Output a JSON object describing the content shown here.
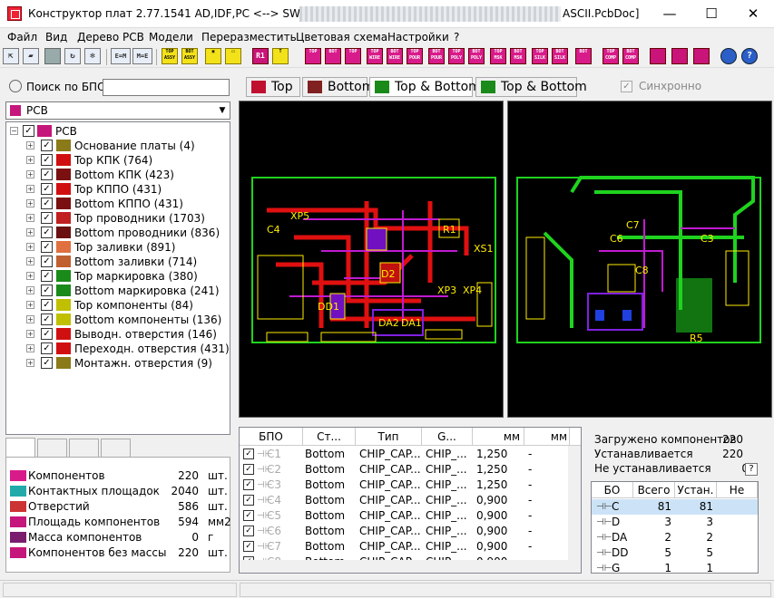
{
  "title": {
    "text": "Конструктор плат 2.77.1541  AD,IDF,PC <--> SW  Demo",
    "suffix": "ASCII.PcbDoc]",
    "minimize": "—",
    "maximize": "☐",
    "close": "✕"
  },
  "menu": [
    "Файл",
    "Вид",
    "Дерево PCB",
    "Модели",
    "Переразместить",
    "Цветовая схема",
    "Настройки",
    "?"
  ],
  "toolbar": {
    "top_labels": [
      "TOP ASSY",
      "BOT ASSY",
      "TOP",
      "BOT",
      "TOP WIRE",
      "BOT WIRE",
      "TOP POUR",
      "BOT POUR",
      "TOP POLY",
      "BOT POLY",
      "TOP MSK",
      "BOT MSK",
      "TOP SILK",
      "BOT SILK",
      "TOP COMP",
      "BOT COMP"
    ],
    "misc_labels": [
      "E=M",
      "M=E",
      "R1"
    ]
  },
  "search": {
    "label": "Поиск по БПО:",
    "value": ""
  },
  "combo": {
    "value": "PCB"
  },
  "tree": {
    "root": "PCB",
    "items": [
      {
        "label": "Основание платы  (4)",
        "icon": "board-base-icon",
        "color": "#8a7a1a"
      },
      {
        "label": "Top КПК  (764)",
        "icon": "smd-pad-icon",
        "color": "#d01010"
      },
      {
        "label": "Bottom КПК  (423)",
        "icon": "smd-pad-icon",
        "color": "#7a1010"
      },
      {
        "label": "Top КППО  (431)",
        "icon": "through-pad-icon",
        "color": "#d01010"
      },
      {
        "label": "Bottom КППО  (431)",
        "icon": "through-pad-icon",
        "color": "#7a1010"
      },
      {
        "label": "Top проводники  (1703)",
        "icon": "track-icon",
        "color": "#c02020"
      },
      {
        "label": "Bottom проводники  (836)",
        "icon": "track-icon",
        "color": "#6a1010"
      },
      {
        "label": "Top заливки  (891)",
        "icon": "polygon-icon",
        "color": "#e07040"
      },
      {
        "label": "Bottom заливки  (714)",
        "icon": "polygon-icon",
        "color": "#c06030"
      },
      {
        "label": "Top маркировка  (380)",
        "icon": "silkscreen-icon",
        "color": "#1a8a1a"
      },
      {
        "label": "Bottom маркировка  (241)",
        "icon": "silkscreen-icon",
        "color": "#1a8a1a"
      },
      {
        "label": "Top компоненты  (84)",
        "icon": "top-component-icon",
        "color": "#c0c000"
      },
      {
        "label": "Bottom компоненты  (136)",
        "icon": "bottom-component-icon",
        "color": "#c0c000"
      },
      {
        "label": "Выводн. отверстия  (146)",
        "icon": "pin-hole-icon",
        "color": "#d01010"
      },
      {
        "label": "Переходн. отверстия  (431)",
        "icon": "via-icon",
        "color": "#d01010"
      },
      {
        "label": "Монтажн. отверстия  (9)",
        "icon": "mount-hole-icon",
        "color": "#8a7a1a"
      }
    ]
  },
  "stats": [
    {
      "name": "Компонентов",
      "value": "220",
      "unit": "шт."
    },
    {
      "name": "Контактных площадок",
      "value": "2040",
      "unit": "шт."
    },
    {
      "name": "Отверстий",
      "value": "586",
      "unit": "шт."
    },
    {
      "name": "Площадь компонентов",
      "value": "594",
      "unit": "мм2"
    },
    {
      "name": "Масса компонентов",
      "value": "0",
      "unit": "г"
    },
    {
      "name": "Компонентов без массы",
      "value": "220",
      "unit": "шт."
    }
  ],
  "view_tabs": [
    "Top",
    "Bottom",
    "Top & Bottom",
    "Top & Bottom"
  ],
  "sync_label": "Синхронно",
  "grid": {
    "headers": [
      "БПО",
      "Ст...",
      "Тип",
      "G...",
      "мм",
      "мм"
    ],
    "rows": [
      [
        "C1",
        "Bottom",
        "CHIP_CAP...",
        "CHIP_...",
        "1,250",
        "-"
      ],
      [
        "C2",
        "Bottom",
        "CHIP_CAP...",
        "CHIP_...",
        "1,250",
        "-"
      ],
      [
        "C3",
        "Bottom",
        "CHIP_CAP...",
        "CHIP_...",
        "1,250",
        "-"
      ],
      [
        "C4",
        "Bottom",
        "CHIP_CAP...",
        "CHIP_...",
        "0,900",
        "-"
      ],
      [
        "C5",
        "Bottom",
        "CHIP_CAP...",
        "CHIP_...",
        "0,900",
        "-"
      ],
      [
        "C6",
        "Bottom",
        "CHIP_CAP...",
        "CHIP_...",
        "0,900",
        "-"
      ],
      [
        "C7",
        "Bottom",
        "CHIP_CAP...",
        "CHIP_...",
        "0,900",
        "-"
      ],
      [
        "C8",
        "Bottom",
        "CHIP_CAP...",
        "CHIP_...",
        "0,900",
        "-"
      ]
    ]
  },
  "summary": [
    {
      "label": "Загружено компонентов",
      "value": "220"
    },
    {
      "label": "Устанавливается",
      "value": "220"
    },
    {
      "label": "Не устанавливается",
      "value": "0"
    }
  ],
  "summary_help": "?",
  "ctable": {
    "headers": [
      "БО",
      "Всего",
      "Устан.",
      "Не уст."
    ],
    "rows": [
      [
        "C",
        "81",
        "81",
        ""
      ],
      [
        "D",
        "3",
        "3",
        ""
      ],
      [
        "DA",
        "2",
        "2",
        ""
      ],
      [
        "DD",
        "5",
        "5",
        ""
      ],
      [
        "G",
        "1",
        "1",
        ""
      ]
    ]
  },
  "pcb": {
    "top_labels": [
      "XP5",
      "DD1",
      "D2",
      "DA2",
      "DA1",
      "XP3",
      "XP4",
      "XS1",
      "C4",
      "R1"
    ],
    "bottom_labels": [
      "C7",
      "C8",
      "C6",
      "R5",
      "C3"
    ]
  }
}
